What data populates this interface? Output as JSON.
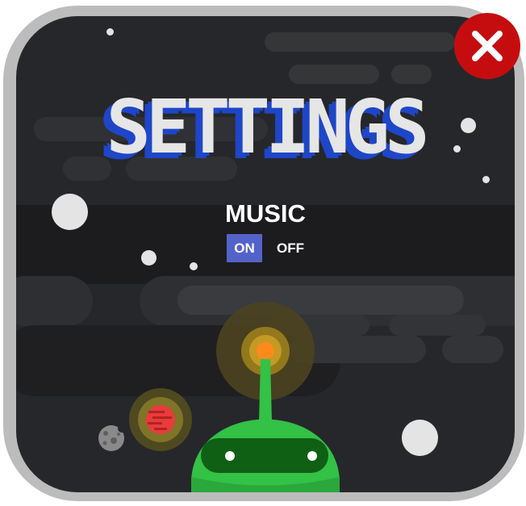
{
  "settings_title": "SETTINGS",
  "music": {
    "label": "MUSIC",
    "on_label": "ON",
    "off_label": "OFF",
    "selected": "ON"
  },
  "close_button": {
    "icon": "close-icon"
  },
  "icons": {
    "planet": "red-planet-icon",
    "moon": "grey-moon-icon",
    "robot": "green-robot-icon"
  },
  "colors": {
    "panel_background": "#26272b",
    "frame": "#bcbcbc",
    "close_button": "#c50d10",
    "title_shadow": "#1e46c8",
    "toggle_active": "#5463c9",
    "robot": "#33c146",
    "antenna_light": "#ff8a1c"
  }
}
